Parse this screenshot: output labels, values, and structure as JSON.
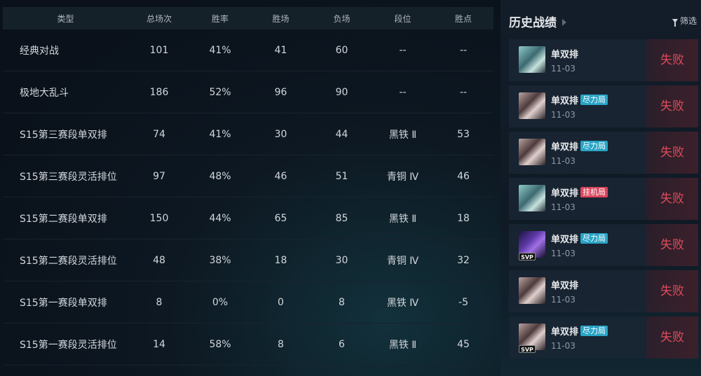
{
  "stats": {
    "headers": [
      "类型",
      "总场次",
      "胜率",
      "胜场",
      "负场",
      "段位",
      "胜点"
    ],
    "rows": [
      [
        "经典对战",
        "101",
        "41%",
        "41",
        "60",
        "--",
        "--"
      ],
      [
        "极地大乱斗",
        "186",
        "52%",
        "96",
        "90",
        "--",
        "--"
      ],
      [
        "S15第三赛段单双排",
        "74",
        "41%",
        "30",
        "44",
        "黑铁 Ⅱ",
        "53"
      ],
      [
        "S15第三赛段灵活排位",
        "97",
        "48%",
        "46",
        "51",
        "青铜 Ⅳ",
        "46"
      ],
      [
        "S15第二赛段单双排",
        "150",
        "44%",
        "65",
        "85",
        "黑铁 Ⅱ",
        "18"
      ],
      [
        "S15第二赛段灵活排位",
        "48",
        "38%",
        "18",
        "30",
        "青铜 Ⅳ",
        "32"
      ],
      [
        "S15第一赛段单双排",
        "8",
        "0%",
        "0",
        "8",
        "黑铁 Ⅳ",
        "-5"
      ],
      [
        "S15第一赛段灵活排位",
        "14",
        "58%",
        "8",
        "6",
        "黑铁 Ⅱ",
        "45"
      ]
    ]
  },
  "history": {
    "title": "历史战绩",
    "filter_label": "筛选",
    "filter_icon": "funnel-icon",
    "matches": [
      {
        "mode": "单双排",
        "tag": "",
        "tag_color": "",
        "date": "11-03",
        "result": "失败",
        "avatar": "champion-avatar-1",
        "svp": ""
      },
      {
        "mode": "单双排",
        "tag": "尽力局",
        "tag_color": "#2aa4c6",
        "date": "11-03",
        "result": "失败",
        "avatar": "champion-avatar-2",
        "svp": ""
      },
      {
        "mode": "单双排",
        "tag": "尽力局",
        "tag_color": "#2aa4c6",
        "date": "11-03",
        "result": "失败",
        "avatar": "champion-avatar-2",
        "svp": ""
      },
      {
        "mode": "单双排",
        "tag": "挂机局",
        "tag_color": "#d9455c",
        "date": "11-03",
        "result": "失败",
        "avatar": "champion-avatar-1",
        "svp": ""
      },
      {
        "mode": "单双排",
        "tag": "尽力局",
        "tag_color": "#2aa4c6",
        "date": "11-03",
        "result": "失败",
        "avatar": "champion-avatar-3",
        "svp": "SVP"
      },
      {
        "mode": "单双排",
        "tag": "",
        "tag_color": "",
        "date": "11-03",
        "result": "失败",
        "avatar": "champion-avatar-2",
        "svp": ""
      },
      {
        "mode": "单双排",
        "tag": "尽力局",
        "tag_color": "#2aa4c6",
        "date": "11-03",
        "result": "失败",
        "avatar": "champion-avatar-2",
        "svp": "SVP"
      }
    ]
  },
  "colors": {
    "loss": "#e04b5c",
    "tag_effort": "#2aa4c6",
    "tag_afk": "#d9455c"
  }
}
